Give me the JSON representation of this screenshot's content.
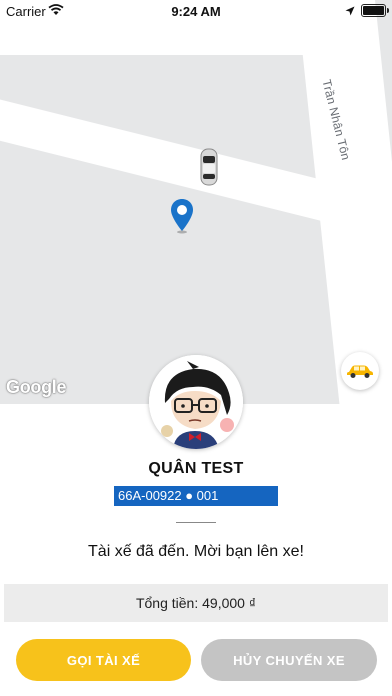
{
  "status_bar": {
    "carrier": "Carrier",
    "time": "9:24 AM",
    "battery_level": 1.0
  },
  "map": {
    "street_name": "Trần Nhân Tôn",
    "attribution": "Google"
  },
  "driver": {
    "name": "QUÂN TEST",
    "plate": "66A-00922 ● 001"
  },
  "trip": {
    "status_message": "Tài xế đã đến. Mời bạn lên xe!",
    "total_label": "Tổng tiền: 49,000 ₫"
  },
  "actions": {
    "call_driver": "GỌI TÀI XẾ",
    "cancel_trip": "HỦY CHUYẾN XE"
  },
  "colors": {
    "accent_yellow": "#f7c21b",
    "plate_blue": "#1565c0",
    "cancel_gray": "#c4c4c4",
    "map_bg": "#e6e7e8"
  }
}
